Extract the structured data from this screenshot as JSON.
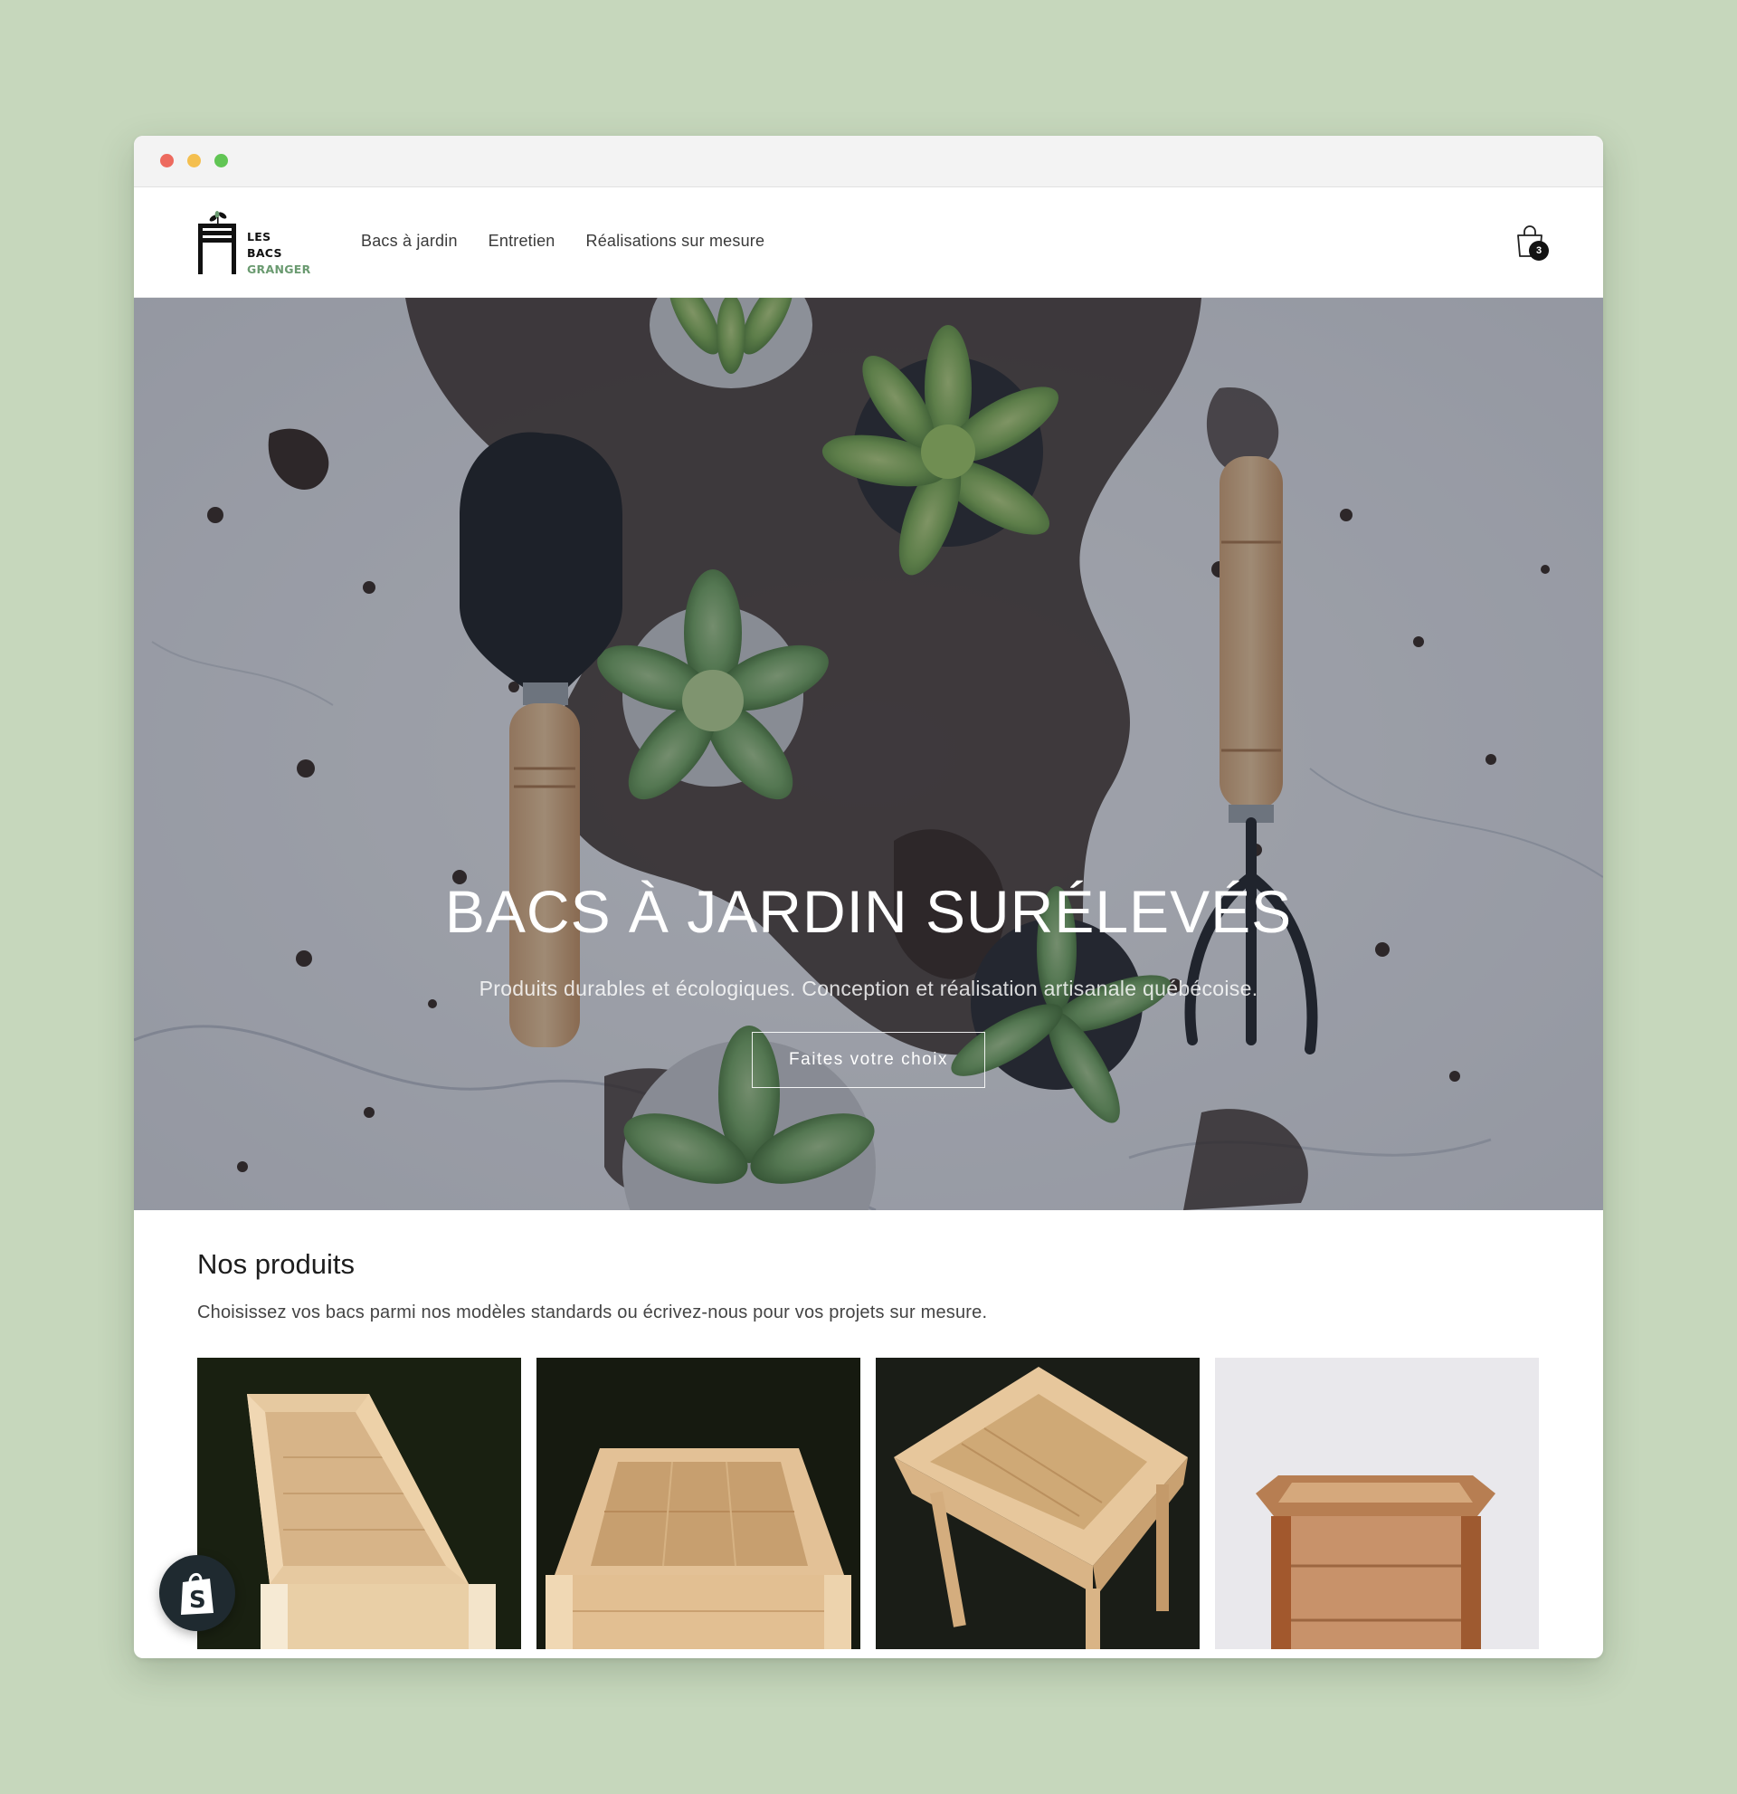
{
  "browser": {
    "controls": [
      "close",
      "minimize",
      "maximize"
    ]
  },
  "header": {
    "logo": {
      "line1": "LES",
      "line2": "BACS",
      "line3": "GRANGER"
    },
    "nav": [
      "Bacs à jardin",
      "Entretien",
      "Réalisations sur mesure"
    ],
    "cart": {
      "icon": "shopping-bag-icon",
      "count": "3"
    }
  },
  "hero": {
    "title": "BACS À JARDIN SURÉLEVÉS",
    "subtitle": "Produits durables et écologiques. Conception et réalisation artisanale québécoise.",
    "cta": "Faites votre choix"
  },
  "products": {
    "heading": "Nos produits",
    "description": "Choisissez vos bacs parmi nos modèles standards ou écrivez-nous pour vos projets sur mesure.",
    "items": [
      "cedar-planter-long",
      "cedar-planter-rectangular",
      "cedar-planter-square-legs",
      "reclaimed-wood-planter"
    ]
  },
  "colors": {
    "accent_green": "#6a9a70",
    "background": "#c6d7bc",
    "wood": "#d9b88f"
  },
  "badge": {
    "icon": "shopify-bag-icon"
  }
}
